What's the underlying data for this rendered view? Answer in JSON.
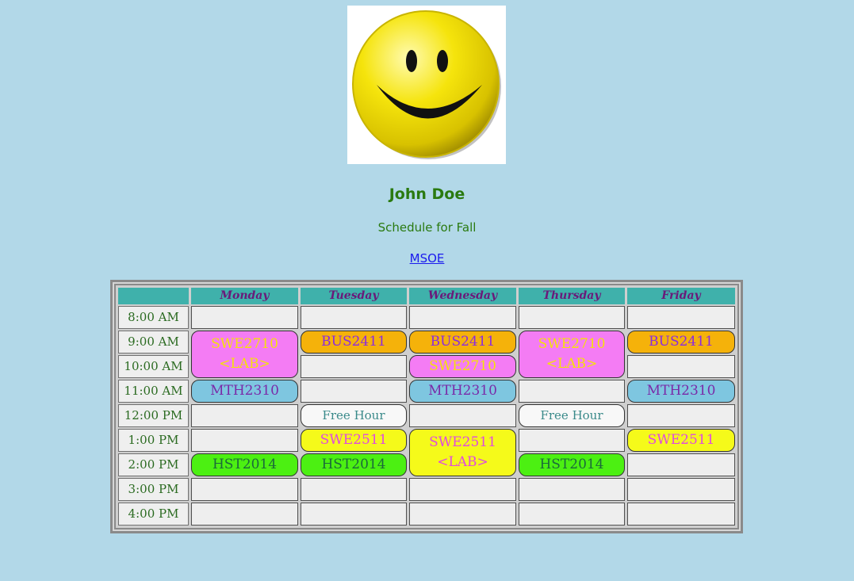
{
  "header": {
    "name": "John Doe",
    "subtitle": "Schedule for Fall",
    "link": "MSOE"
  },
  "colors": {
    "background": "#b2d8e8",
    "header_cell": "#3fb1ab",
    "swe_lab": "#f47cf4",
    "bus": "#f5b20a",
    "swe2710": "#f47cf4",
    "mth": "#7ec6e0",
    "free": "#f8f8f8",
    "swe2511": "#f5fa1a",
    "hst": "#4cf012"
  },
  "days": [
    "Monday",
    "Tuesday",
    "Wednesday",
    "Thursday",
    "Friday"
  ],
  "times": [
    "8:00 AM",
    "9:00 AM",
    "10:00 AM",
    "11:00 AM",
    "12:00 PM",
    "1:00 PM",
    "2:00 PM",
    "3:00 PM",
    "4:00 PM"
  ],
  "events": {
    "mon_swe2710": {
      "line1": "SWE2710",
      "line2": "<LAB>"
    },
    "tue_bus": {
      "line1": "BUS2411"
    },
    "wed_bus": {
      "line1": "BUS2411"
    },
    "thu_swe2710": {
      "line1": "SWE2710",
      "line2": "<LAB>"
    },
    "fri_bus": {
      "line1": "BUS2411"
    },
    "wed_swe2710": {
      "line1": "SWE2710"
    },
    "mon_mth": {
      "line1": "MTH2310"
    },
    "wed_mth": {
      "line1": "MTH2310"
    },
    "fri_mth": {
      "line1": "MTH2310"
    },
    "tue_free": {
      "line1": "Free Hour"
    },
    "thu_free": {
      "line1": "Free Hour"
    },
    "tue_swe2511": {
      "line1": "SWE2511"
    },
    "wed_swe2511": {
      "line1": "SWE2511",
      "line2": "<LAB>"
    },
    "fri_swe2511": {
      "line1": "SWE2511"
    },
    "mon_hst": {
      "line1": "HST2014"
    },
    "tue_hst": {
      "line1": "HST2014"
    },
    "thu_hst": {
      "line1": "HST2014"
    }
  }
}
